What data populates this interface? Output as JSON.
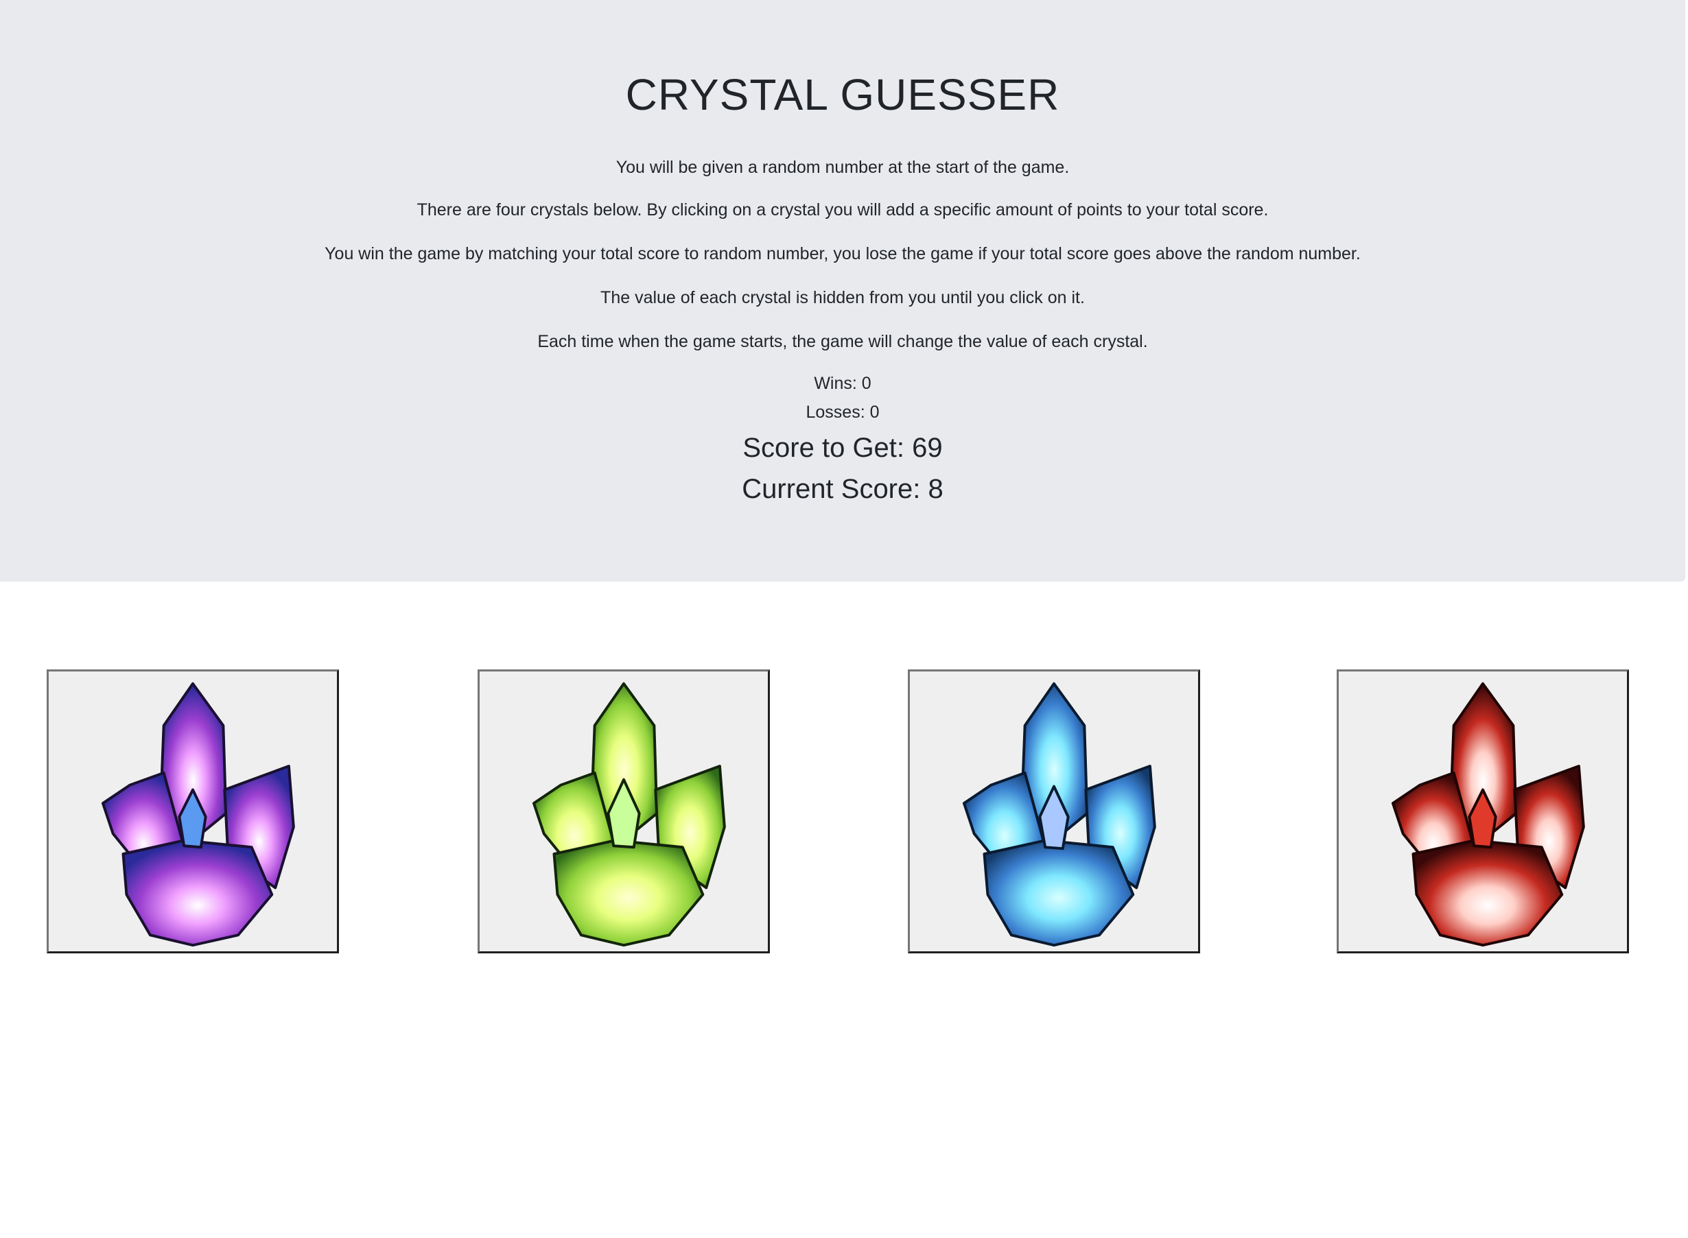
{
  "header": {
    "title": "CRYSTAL GUESSER",
    "instructions": [
      "You will be given a random number at the start of the game.",
      "There are four crystals below. By clicking on a crystal you will add a specific amount of points to your total score.",
      "You win the game by matching your total score to random number, you lose the game if your total score goes above the random number.",
      "The value of each crystal is hidden from you until you click on it.",
      "Each time when the game starts, the game will change the value of each crystal."
    ]
  },
  "stats": {
    "wins": "Wins: 0",
    "losses": "Losses: 0",
    "score_to_get": "Score to Get: 69",
    "current_score": "Current Score: 8"
  },
  "crystals": [
    {
      "icon": "purple-crystal-icon",
      "color": "#9b3fd0",
      "accent": "#f0a0ff"
    },
    {
      "icon": "green-crystal-icon",
      "color": "#8fd13a",
      "accent": "#e8ff80"
    },
    {
      "icon": "blue-crystal-icon",
      "color": "#3a7fcf",
      "accent": "#80e8ff"
    },
    {
      "icon": "red-crystal-icon",
      "color": "#c42a20",
      "accent": "#ffd0c8"
    }
  ],
  "colors": {
    "jumbotron_bg": "#e9eaee",
    "button_bg": "#efefef"
  }
}
